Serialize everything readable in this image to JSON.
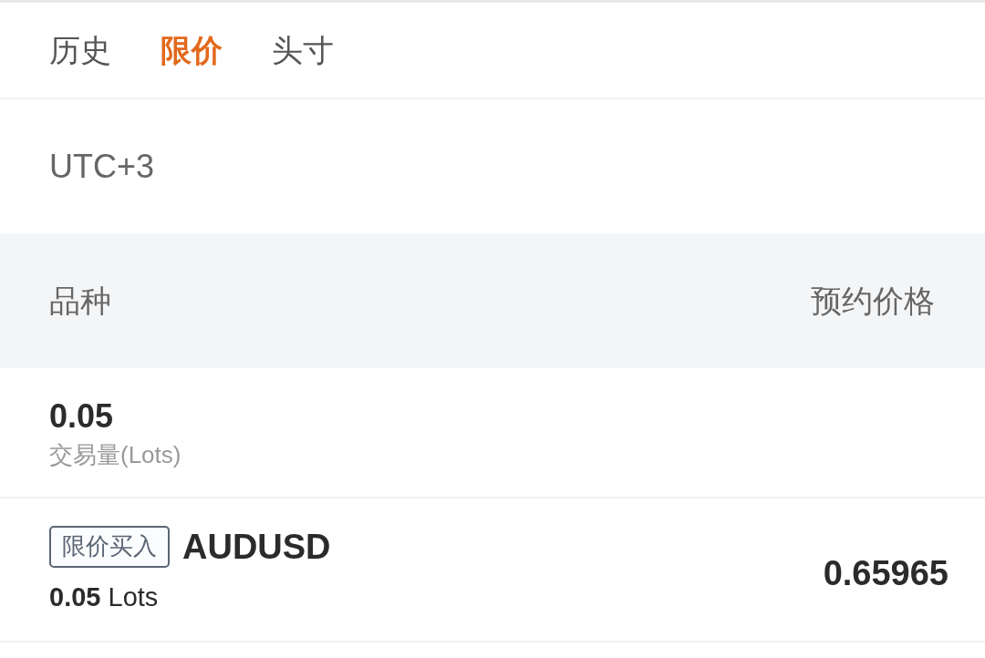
{
  "tabs": [
    {
      "label": "历史",
      "selected": false
    },
    {
      "label": "限价",
      "selected": true
    },
    {
      "label": "头寸",
      "selected": false
    }
  ],
  "timezone": "UTC+3",
  "table": {
    "columns": [
      "品种",
      "预约价格"
    ],
    "rows": [
      {
        "kind": "summary",
        "value": "0.05",
        "label": "交易量(Lots)"
      },
      {
        "kind": "order",
        "tag": "限价买入",
        "symbol": "AUDUSD",
        "volume": "**0.05** Lots",
        "price": "0.65965"
      }
    ]
  }
}
